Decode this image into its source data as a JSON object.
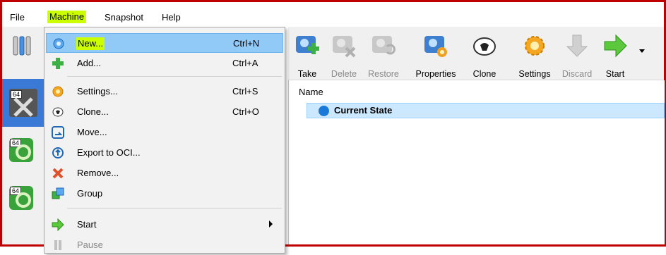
{
  "menubar": {
    "items": [
      {
        "label": "File"
      },
      {
        "label": "Machine"
      },
      {
        "label": "Snapshot"
      },
      {
        "label": "Help"
      }
    ]
  },
  "machine_menu": {
    "items": [
      {
        "label": "New...",
        "shortcut": "Ctrl+N",
        "icon": "new-vm-icon"
      },
      {
        "label": "Add...",
        "shortcut": "Ctrl+A",
        "icon": "add-icon"
      },
      {
        "label": "Settings...",
        "shortcut": "Ctrl+S",
        "icon": "settings-gear-icon"
      },
      {
        "label": "Clone...",
        "shortcut": "Ctrl+O",
        "icon": "clone-sheep-icon"
      },
      {
        "label": "Move...",
        "shortcut": "",
        "icon": "move-icon"
      },
      {
        "label": "Export to OCI...",
        "shortcut": "",
        "icon": "export-icon"
      },
      {
        "label": "Remove...",
        "shortcut": "",
        "icon": "remove-icon"
      },
      {
        "label": "Group",
        "shortcut": "",
        "icon": "group-icon"
      },
      {
        "label": "Start",
        "shortcut": "",
        "icon": "start-arrow-icon"
      },
      {
        "label": "Pause",
        "shortcut": "",
        "icon": "pause-icon"
      }
    ]
  },
  "toolbar": {
    "take": "Take",
    "delete": "Delete",
    "restore": "Restore",
    "properties": "Properties",
    "clone": "Clone",
    "settings": "Settings",
    "discard": "Discard",
    "start": "Start"
  },
  "snapshots": {
    "column_header": "Name",
    "current_state": "Current State"
  },
  "vm_list": {
    "badge": "64"
  },
  "colors": {
    "border": "#c00000",
    "highlight": "#ccff00",
    "selection": "#91c9f7",
    "state_row": "#cce8ff"
  }
}
